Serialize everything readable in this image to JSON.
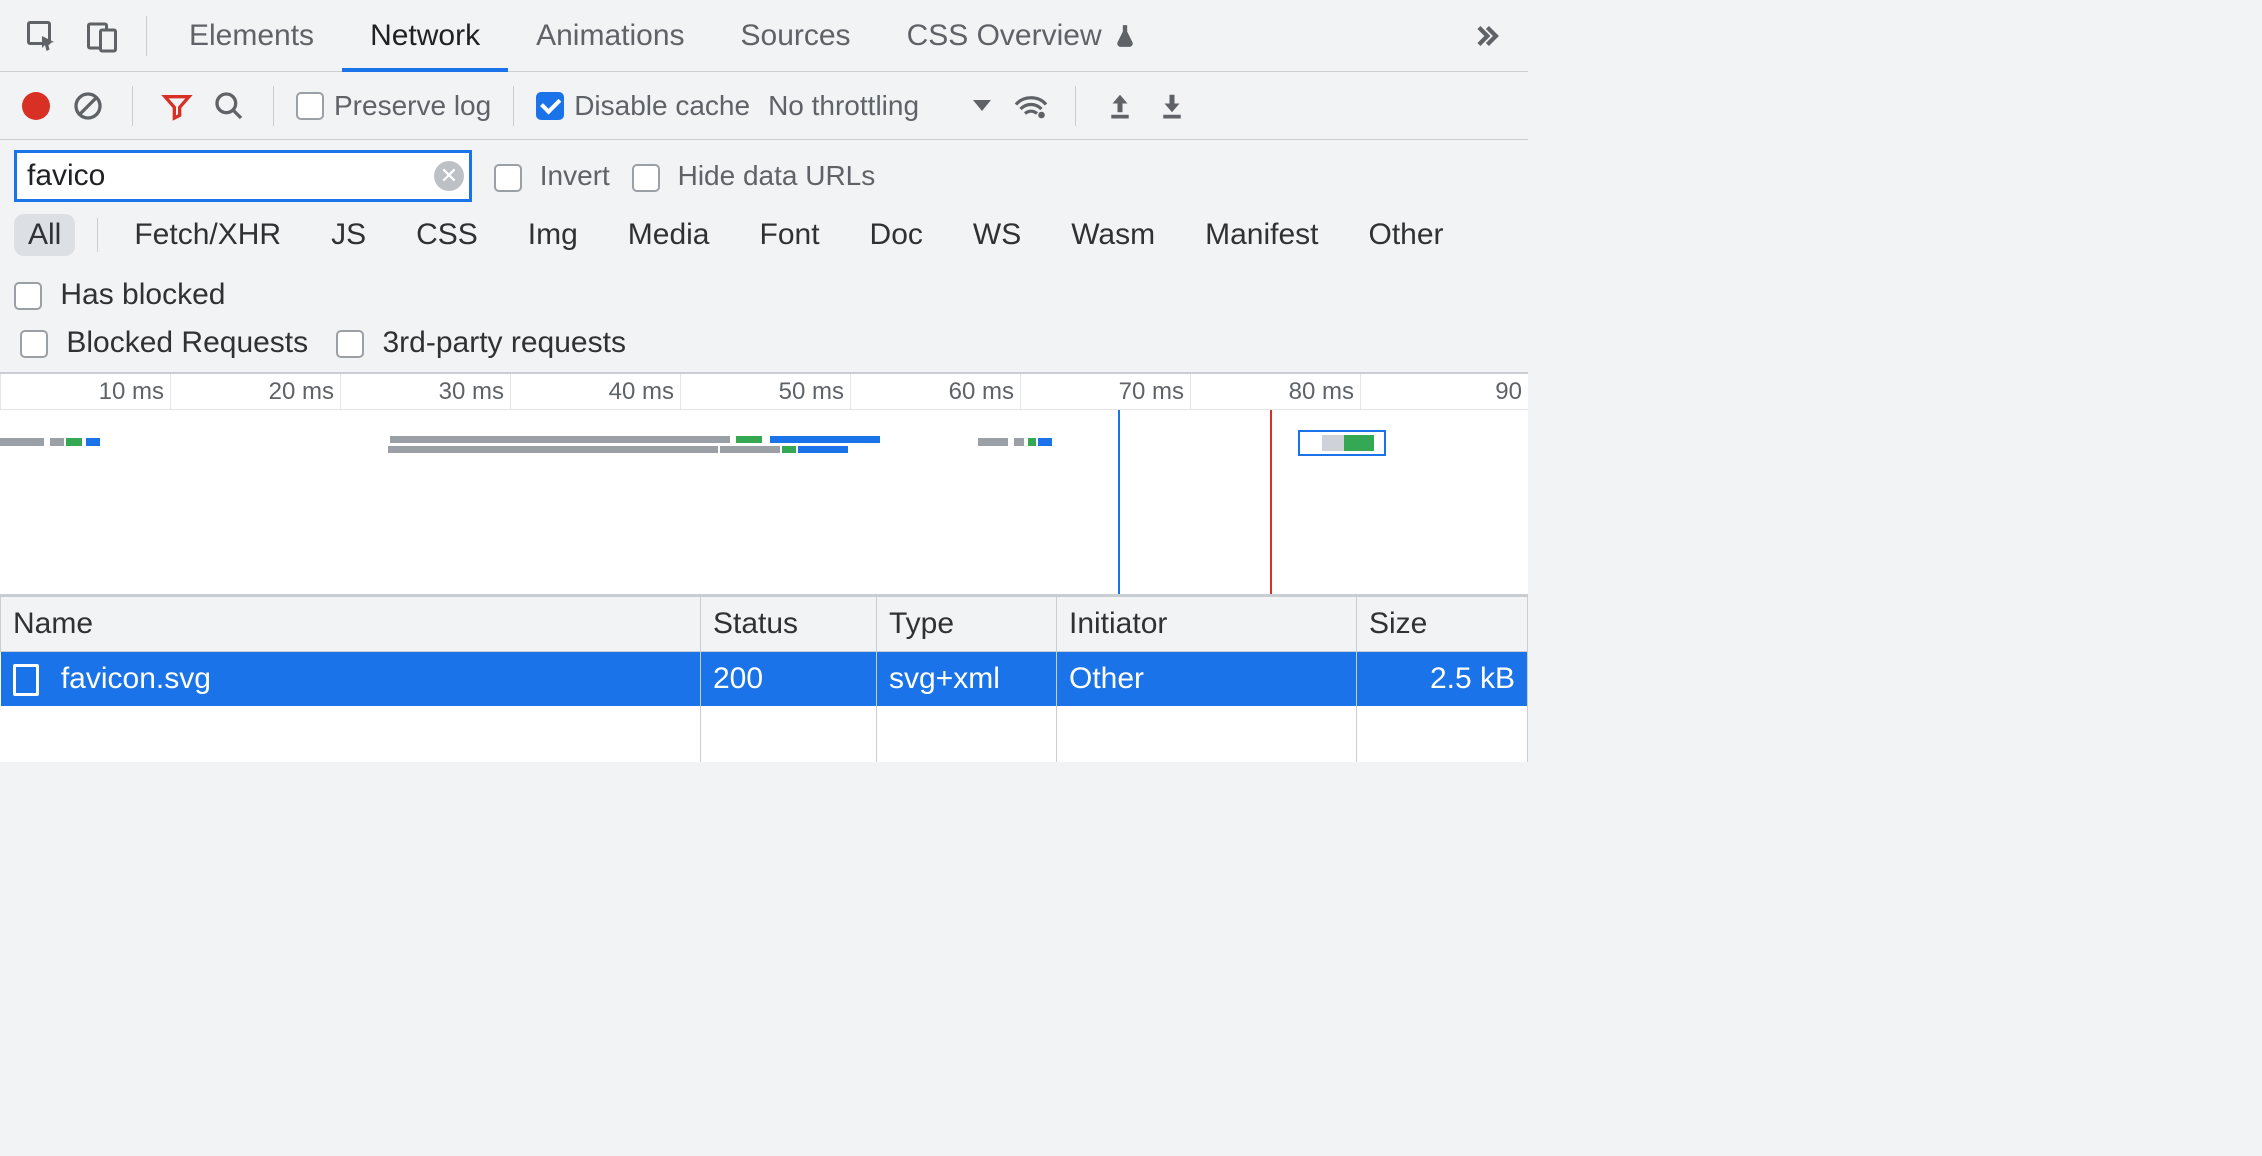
{
  "tabs": {
    "elements": "Elements",
    "network": "Network",
    "animations": "Animations",
    "sources": "Sources",
    "css_overview": "CSS Overview",
    "active": "network"
  },
  "toolbar": {
    "preserve_log": "Preserve log",
    "preserve_log_checked": false,
    "disable_cache": "Disable cache",
    "disable_cache_checked": true,
    "throttling": "No throttling"
  },
  "filter": {
    "value": "favico",
    "invert": "Invert",
    "invert_checked": false,
    "hide_data_urls": "Hide data URLs",
    "hide_data_urls_checked": false
  },
  "types": {
    "all": "All",
    "fetch": "Fetch/XHR",
    "js": "JS",
    "css": "CSS",
    "img": "Img",
    "media": "Media",
    "font": "Font",
    "doc": "Doc",
    "ws": "WS",
    "wasm": "Wasm",
    "manifest": "Manifest",
    "other": "Other",
    "active": "all",
    "has_blocked": "Has blocked"
  },
  "extra": {
    "blocked_requests": "Blocked Requests",
    "third_party": "3rd-party requests"
  },
  "timeline": {
    "ticks": [
      "10 ms",
      "20 ms",
      "30 ms",
      "40 ms",
      "50 ms",
      "60 ms",
      "70 ms",
      "80 ms",
      "90"
    ]
  },
  "table": {
    "headers": {
      "name": "Name",
      "status": "Status",
      "type": "Type",
      "initiator": "Initiator",
      "size": "Size"
    },
    "row": {
      "name": "favicon.svg",
      "status": "200",
      "type": "svg+xml",
      "initiator": "Other",
      "size": "2.5 kB"
    }
  }
}
